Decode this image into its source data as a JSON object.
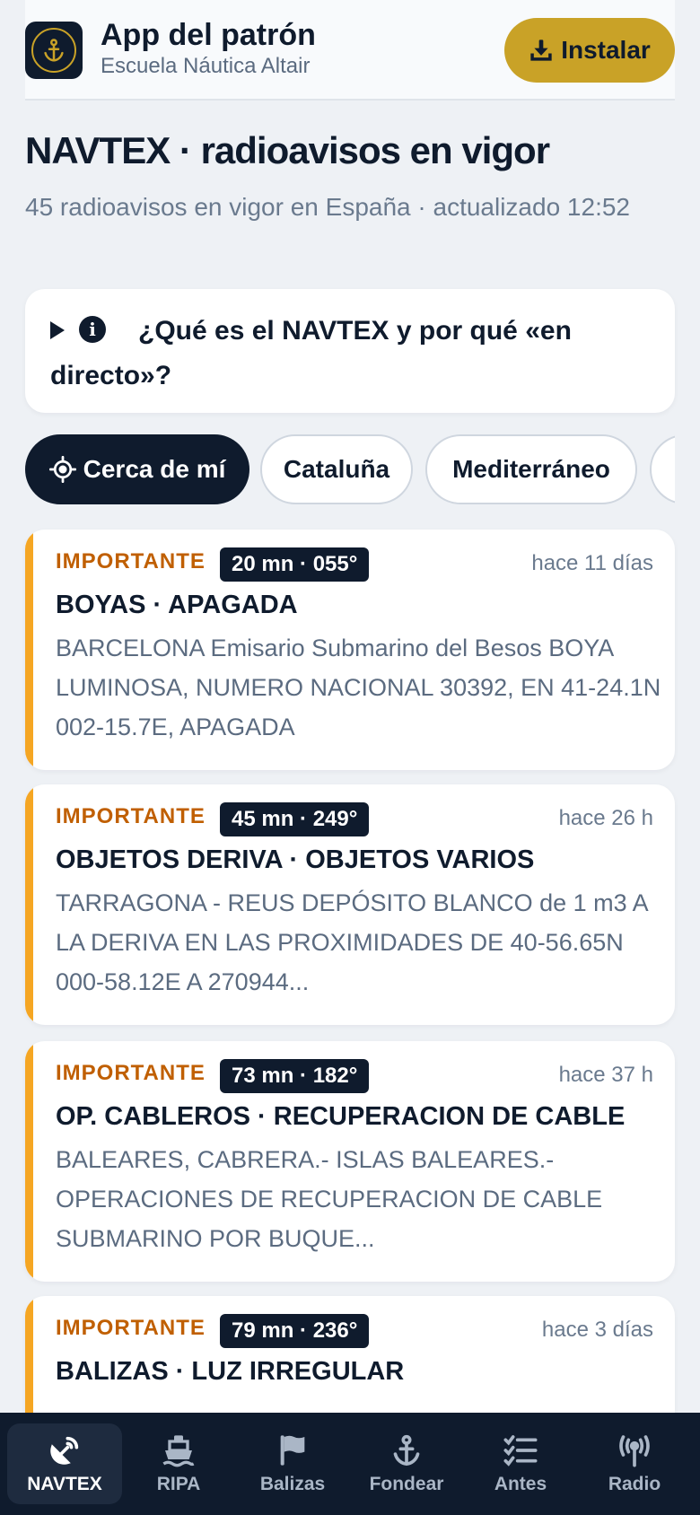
{
  "header": {
    "app_name": "App del patrón",
    "school": "Escuela Náutica Altair",
    "install_label": "Instalar",
    "logo_icon": "anchor-icon"
  },
  "page": {
    "title": "NAVTEX · radioavisos en vigor",
    "summary": "45 radioavisos en vigor en España · actualizado 12:52"
  },
  "info": {
    "question": "¿Qué es el NAVTEX y por qué «en directo»?"
  },
  "filters": {
    "near_me": "Cerca de mí",
    "chips": [
      "Cataluña",
      "Mediterráneo"
    ]
  },
  "warnings": [
    {
      "priority": "IMPORTANTE",
      "distance": "20 mn · 055°",
      "age": "hace 11 días",
      "title": "BOYAS · APAGADA",
      "body": "BARCELONA Emisario Submarino del Besos BOYA LUMINOSA, NUMERO NACIONAL 30392, EN 41-24.1N 002-15.7E, APAGADA"
    },
    {
      "priority": "IMPORTANTE",
      "distance": "45 mn · 249°",
      "age": "hace 26 h",
      "title": "OBJETOS DERIVA · OBJETOS VARIOS",
      "body": "TARRAGONA - REUS DEPÓSITO BLANCO de 1 m3 A LA DERIVA EN LAS PROXIMIDADES DE 40-56.65N 000-58.12E A 270944..."
    },
    {
      "priority": "IMPORTANTE",
      "distance": "73 mn · 182°",
      "age": "hace 37 h",
      "title": "OP. CABLEROS · RECUPERACION DE CABLE",
      "body": "BALEARES, CABRERA.- ISLAS BALEARES.- OPERACIONES DE RECUPERACION DE CABLE SUBMARINO POR BUQUE..."
    },
    {
      "priority": "IMPORTANTE",
      "distance": "79 mn · 236°",
      "age": "hace 3 días",
      "title": "BALIZAS · LUZ IRREGULAR",
      "body": ""
    }
  ],
  "nav": [
    {
      "label": "NAVTEX",
      "icon": "satellite-dish-icon"
    },
    {
      "label": "RIPA",
      "icon": "ship-icon"
    },
    {
      "label": "Balizas",
      "icon": "flag-icon"
    },
    {
      "label": "Fondear",
      "icon": "anchor-icon"
    },
    {
      "label": "Antes",
      "icon": "checklist-icon"
    },
    {
      "label": "Radio",
      "icon": "radio-tower-icon"
    }
  ],
  "colors": {
    "navy": "#0f1b2d",
    "gold": "#c9a227",
    "priority_orange": "#c05f00",
    "card_bar": "#f5a623"
  }
}
